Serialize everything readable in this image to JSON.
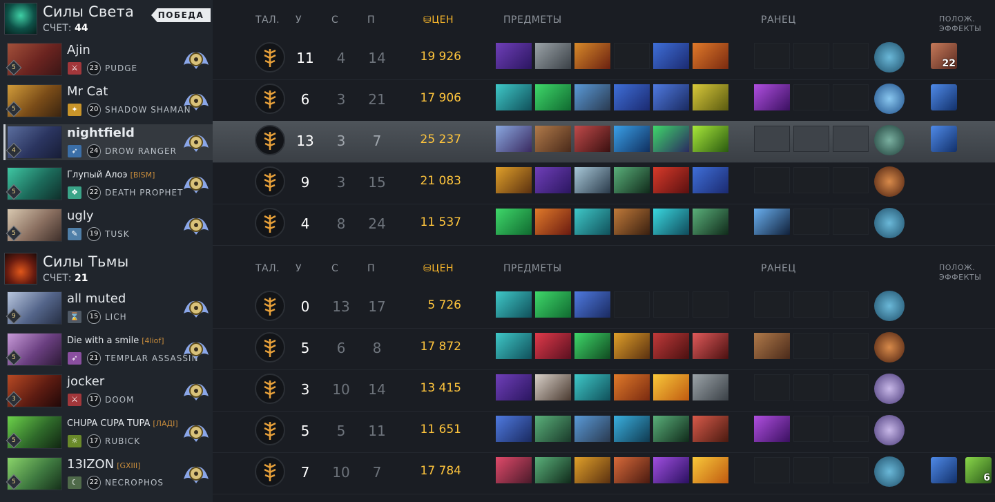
{
  "colors": {
    "gold": "#ffc53d",
    "victory_bg": "#e9ecef"
  },
  "radiant": {
    "name": "Силы Света",
    "score_label": "СЧЕТ:",
    "score": "44",
    "victory_label": "ПОБЕДА",
    "headers": {
      "talent": "ТАЛ.",
      "kills": "У",
      "deaths": "С",
      "assists": "П",
      "networth": "ЦЕН",
      "items": "ПРЕДМЕТЫ",
      "backpack": "РАНЕЦ",
      "buffs_1": "ПОЛОЖ.",
      "buffs_2": "ЭФФЕКТЫ"
    },
    "players": [
      {
        "name": "Ajin",
        "tag": "",
        "level": "23",
        "hero": "PUDGE",
        "badge": "5",
        "k": "11",
        "d": "4",
        "a": "14",
        "nw": "19 926",
        "buff_count": "22"
      },
      {
        "name": "Mr Cat",
        "tag": "",
        "level": "20",
        "hero": "SHADOW SHAMAN",
        "badge": "5",
        "k": "6",
        "d": "3",
        "a": "21",
        "nw": "17 906",
        "buff_count": ""
      },
      {
        "name": "nightfield",
        "tag": "",
        "level": "24",
        "hero": "DROW RANGER",
        "badge": "4",
        "k": "13",
        "d": "3",
        "a": "7",
        "nw": "25 237",
        "buff_count": ""
      },
      {
        "name": "Глупый Алоэ",
        "tag": "[BISM]",
        "level": "22",
        "hero": "DEATH PROPHET",
        "badge": "5",
        "k": "9",
        "d": "3",
        "a": "15",
        "nw": "21 083",
        "buff_count": ""
      },
      {
        "name": "ugly",
        "tag": "",
        "level": "19",
        "hero": "TUSK",
        "badge": "5",
        "k": "4",
        "d": "8",
        "a": "24",
        "nw": "11 537",
        "buff_count": ""
      }
    ]
  },
  "dire": {
    "name": "Силы Тьмы",
    "score_label": "СЧЕТ:",
    "score": "21",
    "headers": {
      "talent": "ТАЛ.",
      "kills": "У",
      "deaths": "С",
      "assists": "П",
      "networth": "ЦЕН",
      "items": "ПРЕДМЕТЫ",
      "backpack": "РАНЕЦ",
      "buffs_1": "ПОЛОЖ.",
      "buffs_2": "ЭФФЕКТЫ"
    },
    "players": [
      {
        "name": "all muted",
        "tag": "",
        "level": "15",
        "hero": "LICH",
        "badge": "9",
        "k": "0",
        "d": "13",
        "a": "17",
        "nw": "5 726",
        "buff_count": ""
      },
      {
        "name": "Die with a smile",
        "tag": "[4liof]",
        "level": "21",
        "hero": "TEMPLAR ASSASSIN",
        "badge": "5",
        "k": "5",
        "d": "6",
        "a": "8",
        "nw": "17 872",
        "buff_count": ""
      },
      {
        "name": "jocker",
        "tag": "",
        "level": "17",
        "hero": "DOOM",
        "badge": "3",
        "k": "3",
        "d": "10",
        "a": "14",
        "nw": "13 415",
        "buff_count": ""
      },
      {
        "name": "CHUPA CUPA TUPA",
        "tag": "[ЛАДІ]",
        "level": "17",
        "hero": "RUBICK",
        "badge": "5",
        "k": "5",
        "d": "5",
        "a": "11",
        "nw": "11 651",
        "buff_count": ""
      },
      {
        "name": "13IZON",
        "tag": "[GXIII]",
        "level": "22",
        "hero": "NECROPHOS",
        "badge": "5",
        "k": "7",
        "d": "10",
        "a": "7",
        "nw": "17 784",
        "buff_count": "6"
      }
    ]
  }
}
